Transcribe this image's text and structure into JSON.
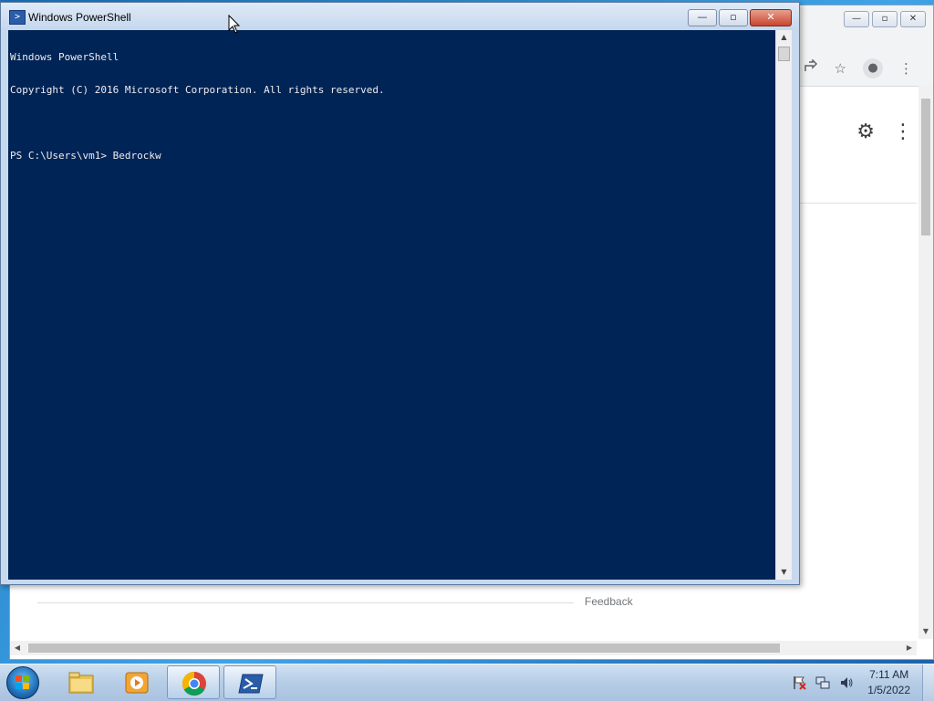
{
  "browser": {
    "controls": {
      "minimize": "—",
      "maximize": "▫",
      "close": "✕"
    },
    "toolbar_icons": [
      "share-icon",
      "star-icon",
      "profile-icon",
      "more-icon"
    ],
    "content_icons": [
      "gear-icon",
      "more-vertical-icon"
    ],
    "feedback_label": "Feedback"
  },
  "powershell": {
    "title": "Windows PowerShell",
    "controls": {
      "minimize": "—",
      "maximize": "▫",
      "close": "✕"
    },
    "console_lines": [
      "Windows PowerShell",
      "Copyright (C) 2016 Microsoft Corporation. All rights reserved.",
      "",
      "PS C:\\Users\\vm1> Bedrockw"
    ]
  },
  "taskbar": {
    "items": [
      {
        "name": "file-explorer",
        "icon": "folder-icon",
        "active": false
      },
      {
        "name": "media-player",
        "icon": "media-player-icon",
        "active": false
      },
      {
        "name": "chrome",
        "icon": "chrome-icon",
        "active": true
      },
      {
        "name": "powershell",
        "icon": "powershell-icon",
        "active": true
      }
    ],
    "tray_icons": [
      "action-center-flag-icon",
      "network-icon",
      "volume-icon"
    ],
    "clock": {
      "time": "7:11 AM",
      "date": "1/5/2022"
    }
  },
  "colors": {
    "console_bg": "#012456",
    "console_fg": "#eeedf0",
    "close_button": "#c8452e",
    "taskbar": "#b6cde6"
  }
}
